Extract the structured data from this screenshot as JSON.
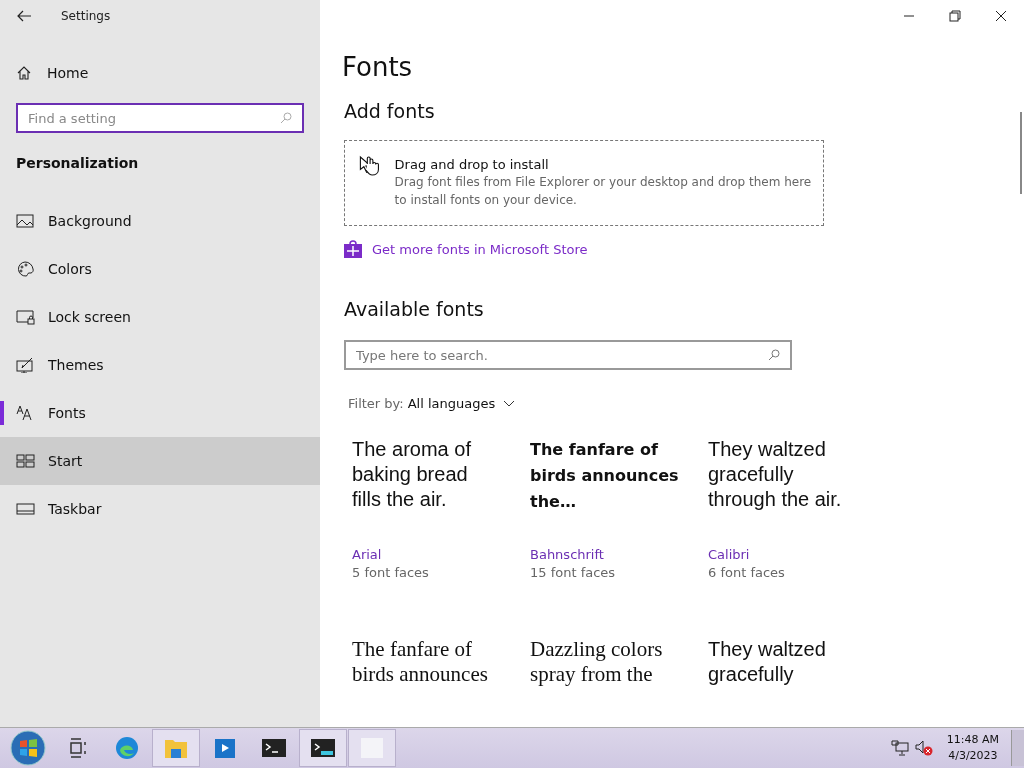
{
  "window": {
    "title": "Settings"
  },
  "sidebar": {
    "home": "Home",
    "search": {
      "placeholder": "Find a setting"
    },
    "section": "Personalization",
    "items": [
      {
        "label": "Background",
        "selected": false,
        "hovered": false
      },
      {
        "label": "Colors",
        "selected": false,
        "hovered": false
      },
      {
        "label": "Lock screen",
        "selected": false,
        "hovered": false
      },
      {
        "label": "Themes",
        "selected": false,
        "hovered": false
      },
      {
        "label": "Fonts",
        "selected": true,
        "hovered": false
      },
      {
        "label": "Start",
        "selected": false,
        "hovered": true
      },
      {
        "label": "Taskbar",
        "selected": false,
        "hovered": false
      }
    ]
  },
  "page": {
    "title": "Fonts",
    "add_heading": "Add fonts",
    "drop_zone": {
      "title": "Drag and drop to install",
      "description": "Drag font files from File Explorer or your desktop and drop them here to install fonts on your device."
    },
    "store_link": "Get more fonts in Microsoft Store",
    "available_heading": "Available fonts",
    "search": {
      "placeholder": "Type here to search."
    },
    "filter": {
      "label": "Filter by:",
      "value": "All languages"
    },
    "fonts": [
      {
        "kind": "arial",
        "preview": "The aroma of baking bread fills the air.",
        "name": "Arial",
        "faces": "5 font faces"
      },
      {
        "kind": "bahnschrift",
        "preview": "The fanfare of birds announces the…",
        "name": "Bahnschrift",
        "faces": "15 font faces"
      },
      {
        "kind": "calibri",
        "preview": "They waltzed gracefully through the air.",
        "name": "Calibri",
        "faces": "6 font faces"
      },
      {
        "kind": "cambria",
        "preview": "The fanfare of birds announces"
      },
      {
        "kind": "cambria",
        "preview": "Dazzling colors spray from the"
      },
      {
        "kind": "calibri",
        "preview": "They waltzed gracefully"
      }
    ]
  },
  "taskbar": {
    "apps": [
      {
        "open": false
      },
      {
        "open": false
      },
      {
        "open": true
      },
      {
        "open": false
      },
      {
        "open": false
      },
      {
        "open": true
      },
      {
        "open": true
      }
    ],
    "time": "11:48 AM",
    "date": "4/3/2023"
  }
}
